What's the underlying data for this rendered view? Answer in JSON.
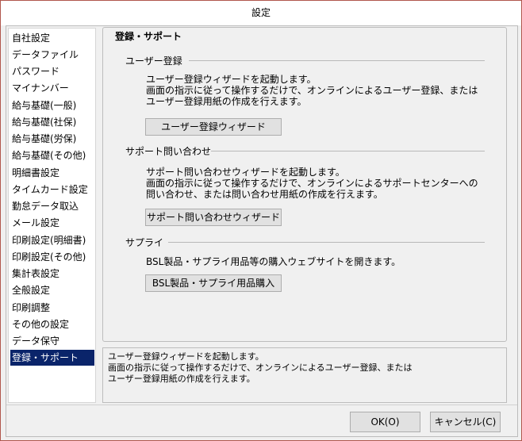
{
  "window": {
    "title": "設定"
  },
  "nav": {
    "items": [
      {
        "label": "自社設定"
      },
      {
        "label": "データファイル"
      },
      {
        "label": "パスワード"
      },
      {
        "label": "マイナンバー"
      },
      {
        "label": "給与基礎(一般)"
      },
      {
        "label": "給与基礎(社保)"
      },
      {
        "label": "給与基礎(労保)"
      },
      {
        "label": "給与基礎(その他)"
      },
      {
        "label": "明細書設定"
      },
      {
        "label": "タイムカード設定"
      },
      {
        "label": "勤怠データ取込"
      },
      {
        "label": "メール設定"
      },
      {
        "label": "印刷設定(明細書)"
      },
      {
        "label": "印刷設定(その他)"
      },
      {
        "label": "集計表設定"
      },
      {
        "label": "全般設定"
      },
      {
        "label": "印刷調整"
      },
      {
        "label": "その他の設定"
      },
      {
        "label": "データ保守"
      },
      {
        "label": "登録・サポート",
        "selected": true
      }
    ]
  },
  "panel": {
    "title": "登録・サポート",
    "sections": [
      {
        "heading": "ユーザー登録",
        "description": "ユーザー登録ウィザードを起動します。\n画面の指示に従って操作するだけで、オンラインによるユーザー登録、または\nユーザー登録用紙の作成を行えます。",
        "button": "ユーザー登録ウィザード"
      },
      {
        "heading": "サポート問い合わせ",
        "description": "サポート問い合わせウィザードを起動します。\n画面の指示に従って操作するだけで、オンラインによるサポートセンターへの\n問い合わせ、または問い合わせ用紙の作成を行えます。",
        "button": "サポート問い合わせウィザード"
      },
      {
        "heading": "サプライ",
        "description": "BSL製品・サプライ用品等の購入ウェブサイトを開きます。",
        "button": "BSL製品・サプライ用品購入"
      }
    ]
  },
  "help": {
    "text": "ユーザー登録ウィザードを起動します。\n画面の指示に従って操作するだけで、オンラインによるユーザー登録、または\nユーザー登録用紙の作成を行えます。"
  },
  "buttons": {
    "ok": "OK(O)",
    "cancel": "キャンセル(C)"
  }
}
